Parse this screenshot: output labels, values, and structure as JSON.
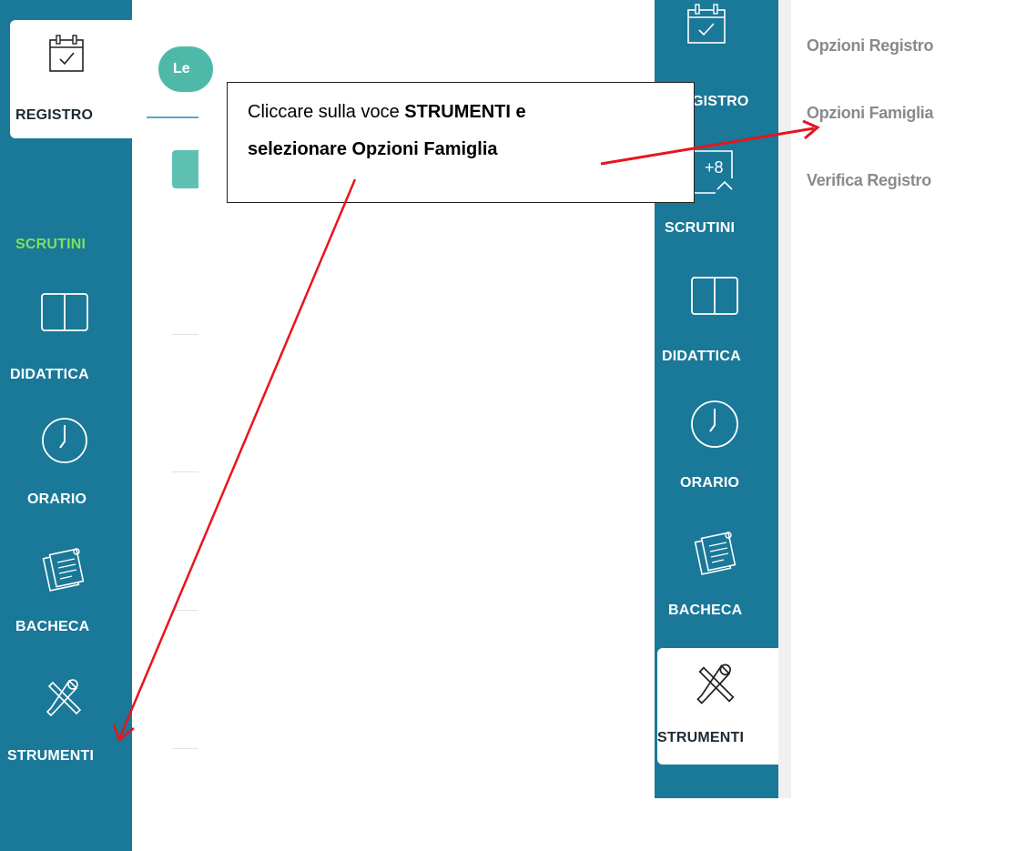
{
  "left_screenshot": {
    "active_item": "REGISTRO",
    "tab_pill_text": "Le",
    "nav": {
      "registro": "REGISTRO",
      "scrutini": "SCRUTINI",
      "didattica": "DIDATTICA",
      "orario": "ORARIO",
      "bacheca": "BACHECA",
      "strumenti": "STRUMENTI"
    },
    "colors": {
      "sidebar": "#1a7898",
      "scrutini_label": "#7fe05a",
      "pill": "#4fb9a9"
    }
  },
  "right_screenshot": {
    "active_item": "STRUMENTI",
    "nav": {
      "registro_partial": "GISTRO",
      "scrutini_badge": "+8",
      "scrutini": "SCRUTINI",
      "didattica": "DIDATTICA",
      "orario": "ORARIO",
      "bacheca": "BACHECA",
      "strumenti": "STRUMENTI"
    },
    "submenu": {
      "items": [
        "Opzioni Registro",
        "Opzioni Famiglia",
        "Verifica Registro"
      ]
    }
  },
  "callout": {
    "line1_prefix": "Cliccare sulla voce ",
    "line1_bold": "STRUMENTI e",
    "line2": "selezionare Opzioni Famiglia"
  },
  "icons": {
    "registro": "calendar-check-icon",
    "scrutini": "calendar-plus-icon",
    "didattica": "book-icon",
    "orario": "clock-icon",
    "bacheca": "notepad-icon",
    "strumenti": "tools-icon"
  },
  "annotation_color": "#e8141e"
}
